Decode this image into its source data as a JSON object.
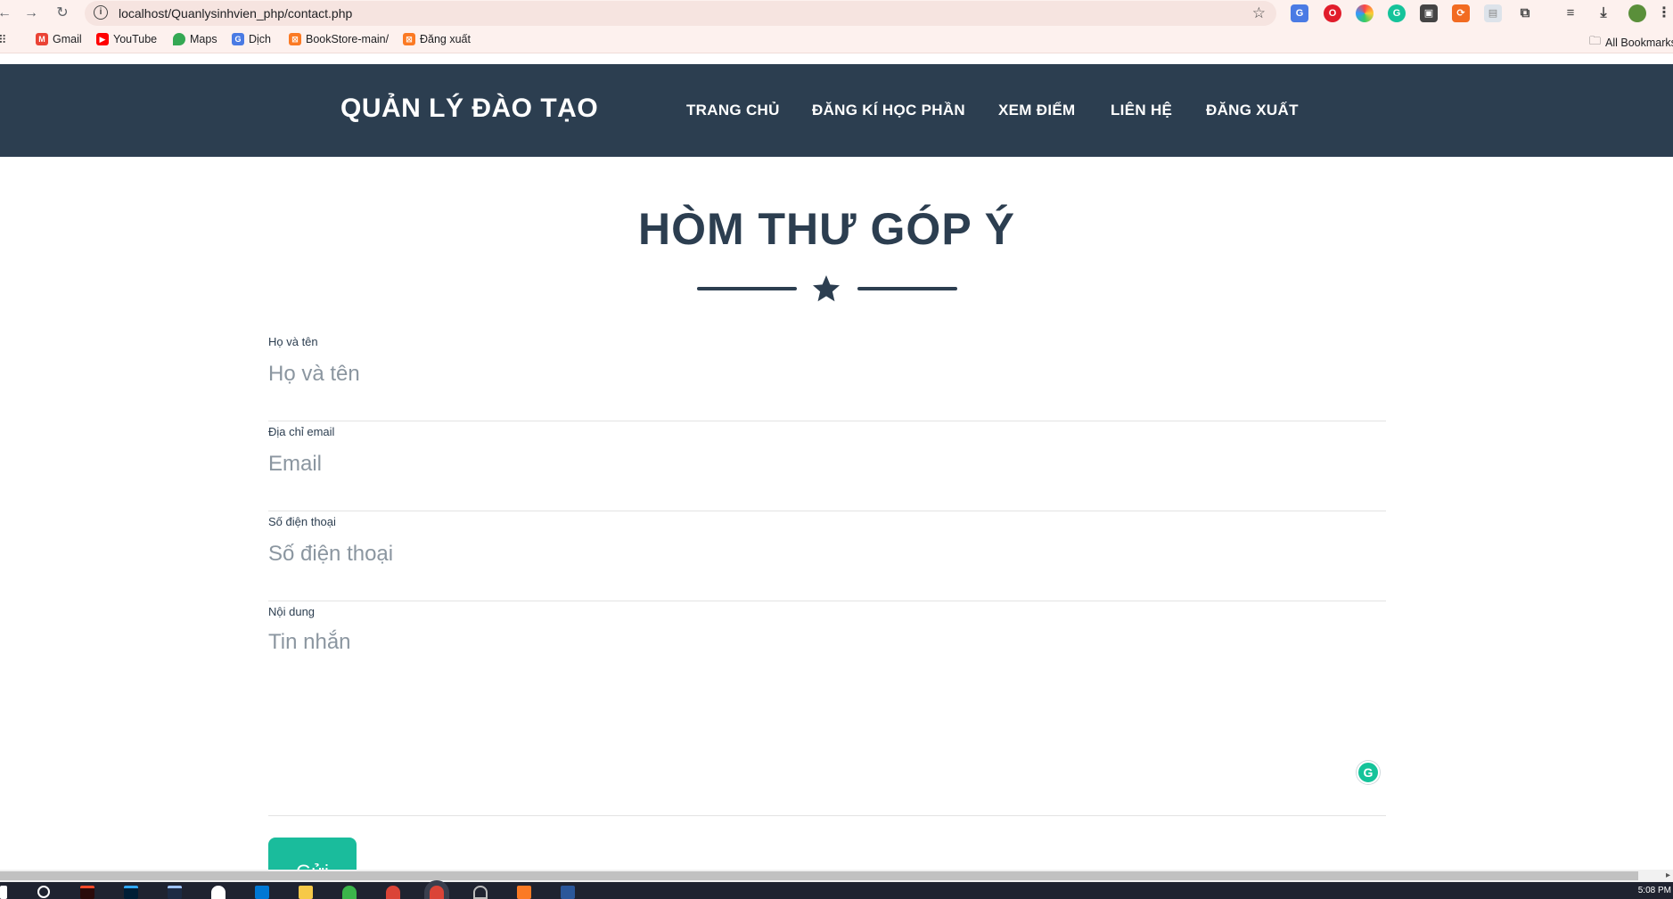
{
  "browser": {
    "url": "localhost/Quanlysinhvien_php/contact.php",
    "bookmarks": [
      "Gmail",
      "YouTube",
      "Maps",
      "Dịch",
      "BookStore-main/",
      "Đăng xuất"
    ],
    "all_bookmarks": "All Bookmarks"
  },
  "nav": {
    "brand": "QUẢN LÝ ĐÀO TẠO",
    "links": [
      "TRANG CHỦ",
      "ĐĂNG KÍ HỌC PHẦN",
      "XEM ĐIỂM",
      "LIÊN HỆ",
      "ĐĂNG XUẤT"
    ]
  },
  "page": {
    "title": "HÒM THƯ GÓP Ý"
  },
  "form": {
    "name": {
      "label": "Họ và tên",
      "placeholder": "Họ và tên"
    },
    "email": {
      "label": "Địa chỉ email",
      "placeholder": "Email"
    },
    "phone": {
      "label": "Số điện thoại",
      "placeholder": "Số điện thoại"
    },
    "message": {
      "label": "Nội dung",
      "placeholder": "Tin nhắn"
    },
    "submit_label": "Gửi"
  },
  "taskbar": {
    "clock": "5:08 PM"
  },
  "colors": {
    "navy": "#2c3e50",
    "accent": "#1abc9c"
  },
  "icons": [
    "back-icon",
    "forward-icon",
    "reload-icon",
    "info-icon",
    "bookmark-star-icon",
    "divider-star-icon",
    "grammarly-icon",
    "folder-icon"
  ]
}
